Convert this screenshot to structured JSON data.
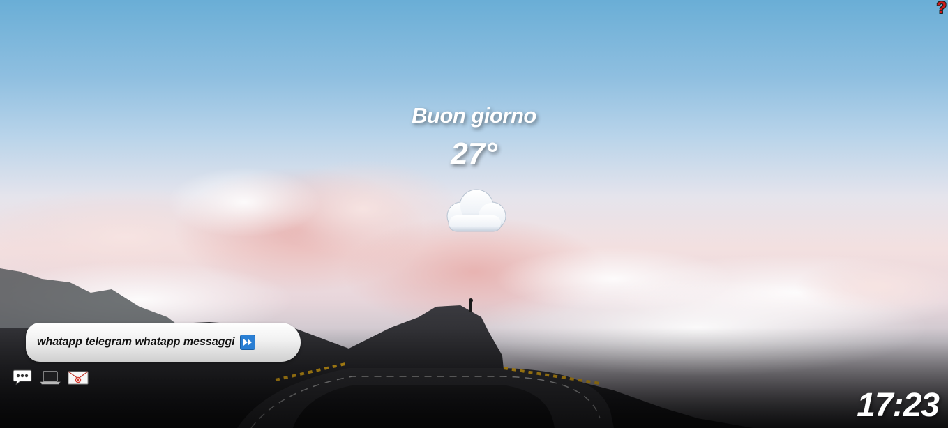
{
  "help": {
    "label": "?",
    "color": "#d11a1a"
  },
  "greeting": "Buon giorno",
  "weather": {
    "temperature": "27°",
    "icon": "cloud-icon"
  },
  "ticker": {
    "text": "whatapp telegram whatapp messaggi",
    "icon": "fast-forward-icon"
  },
  "apps": [
    {
      "name": "messages",
      "icon": "speech-bubble-icon"
    },
    {
      "name": "computer",
      "icon": "laptop-icon"
    },
    {
      "name": "email",
      "icon": "envelope-icon"
    }
  ],
  "clock": "17:23"
}
